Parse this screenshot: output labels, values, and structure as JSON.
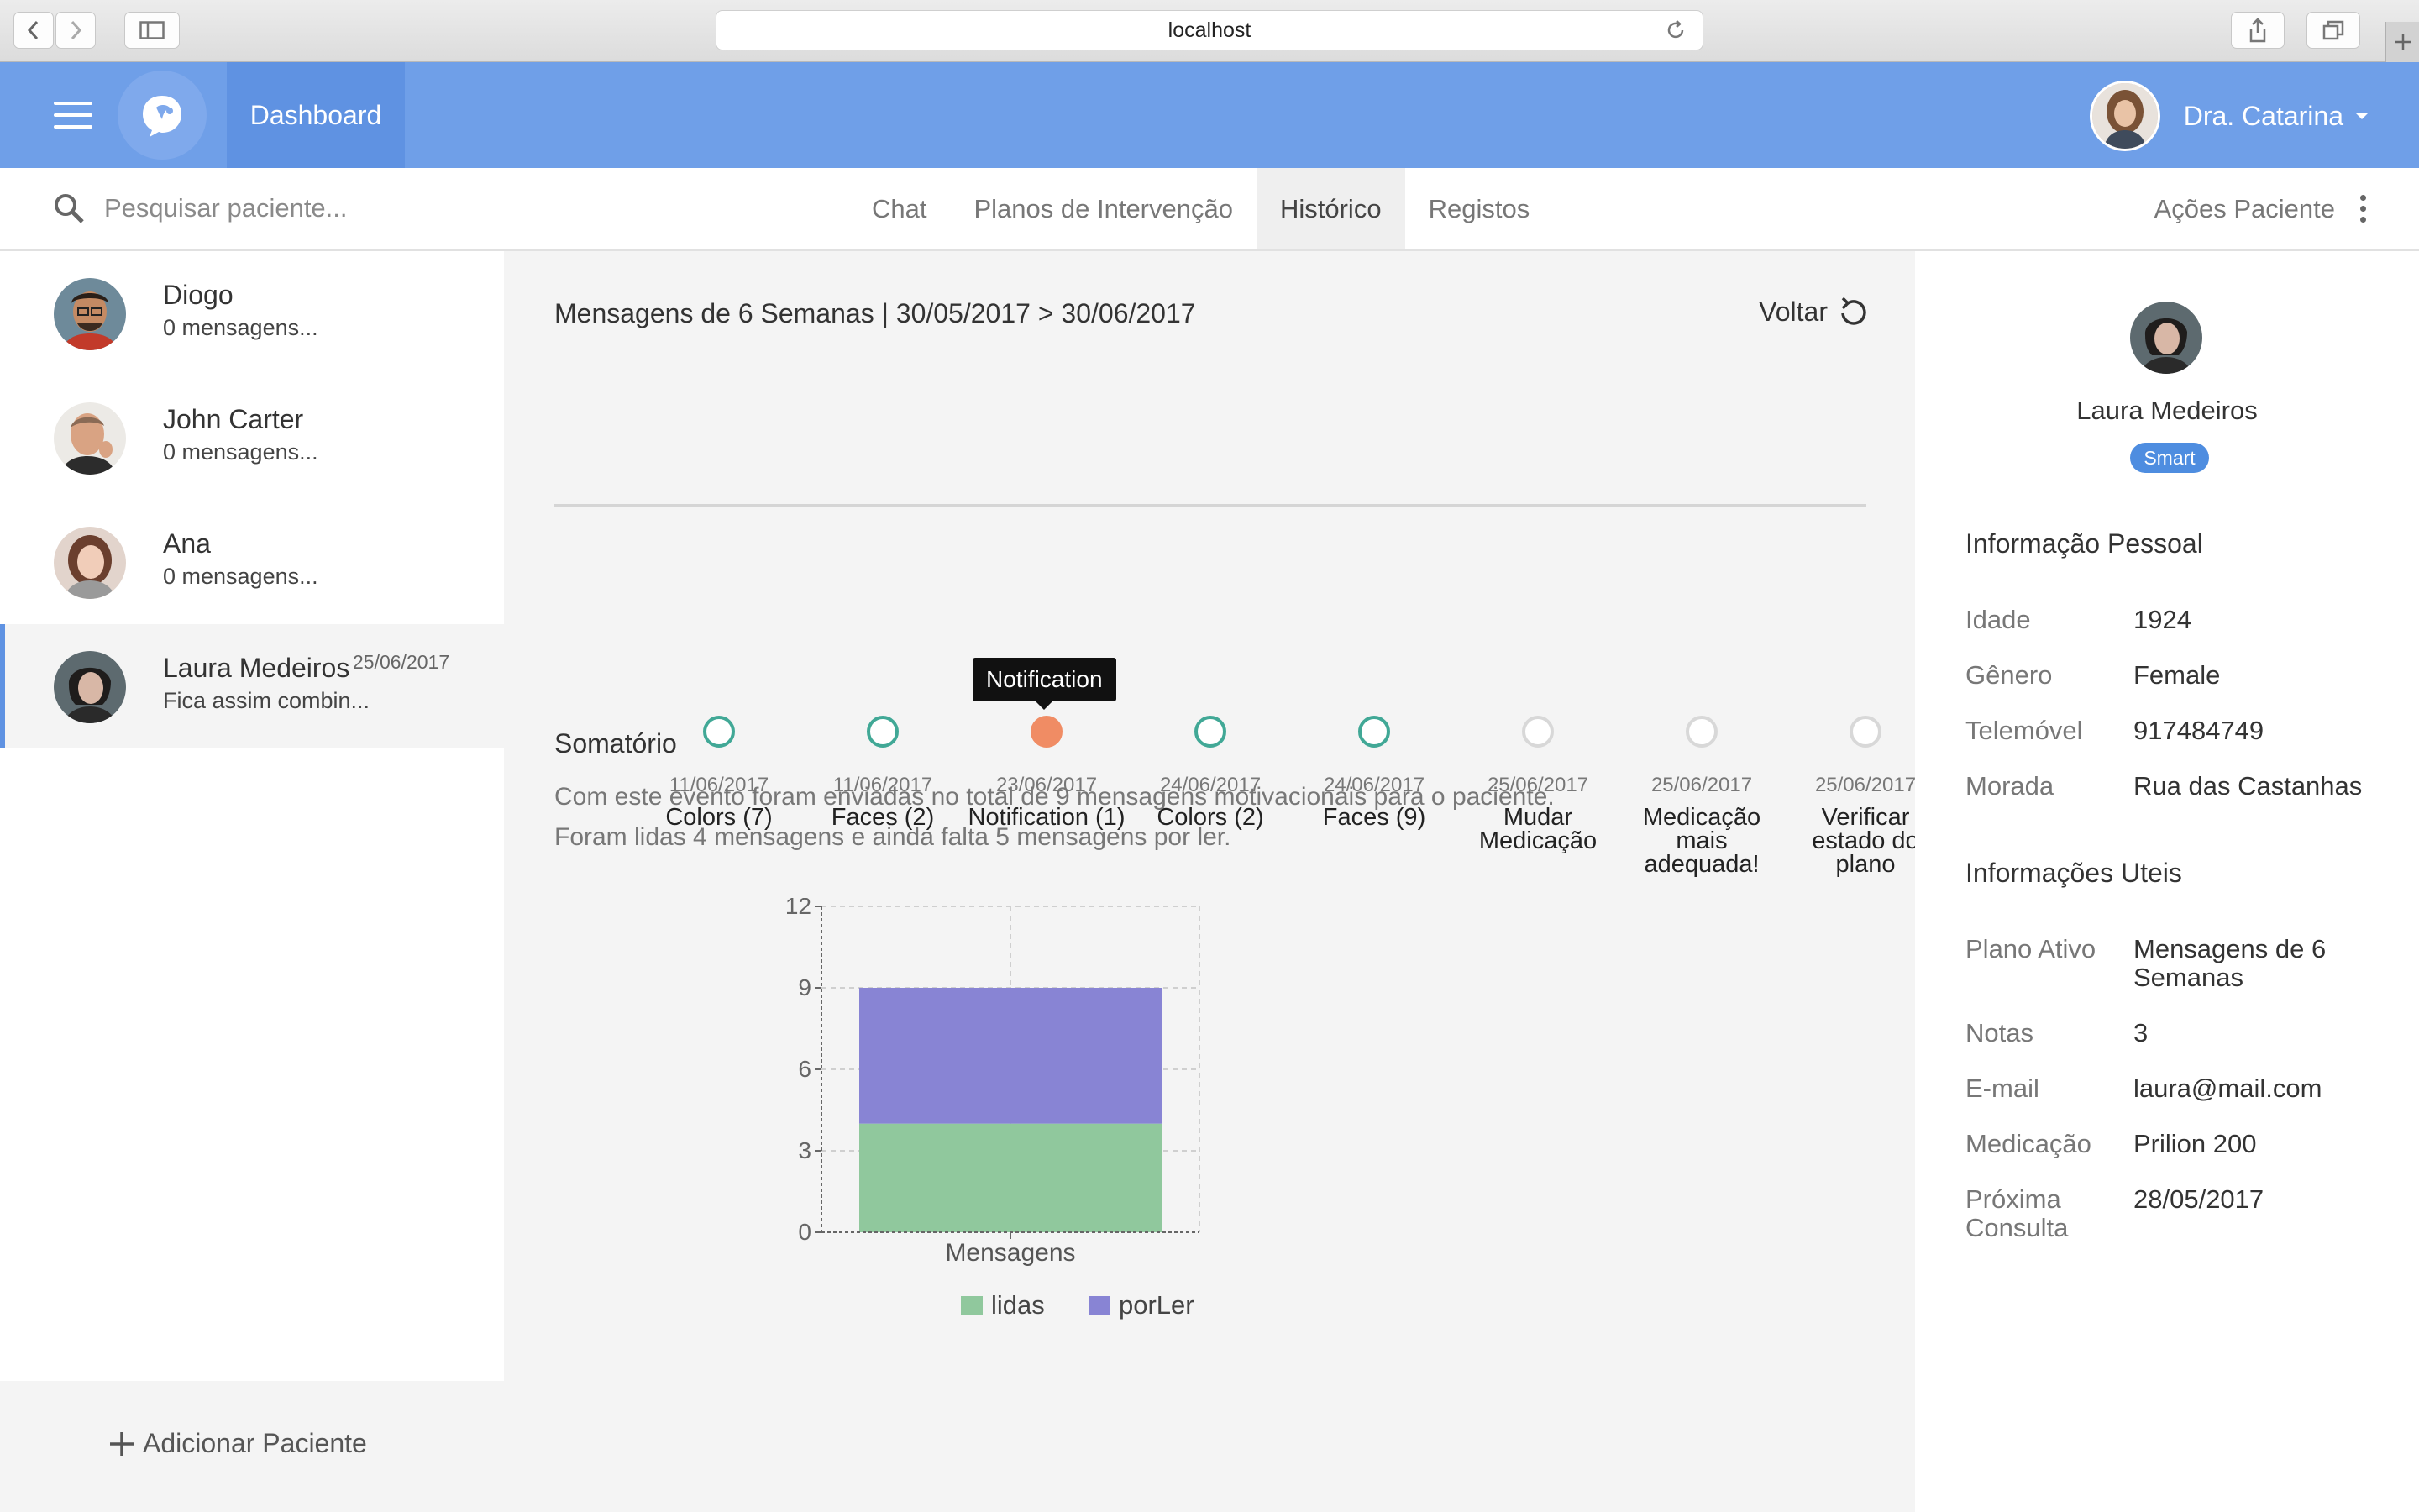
{
  "browser": {
    "url": "localhost"
  },
  "header": {
    "dashboard_label": "Dashboard",
    "user_name": "Dra. Catarina"
  },
  "subnav": {
    "search_placeholder": "Pesquisar paciente...",
    "tabs": [
      "Chat",
      "Planos de Intervenção",
      "Histórico",
      "Registos"
    ],
    "active_tab": "Histórico",
    "actions_label": "Ações Paciente"
  },
  "patients": [
    {
      "name": "Diogo",
      "preview": "0 mensagens...",
      "date": ""
    },
    {
      "name": "John Carter",
      "preview": "0 mensagens...",
      "date": ""
    },
    {
      "name": "Ana",
      "preview": "0 mensagens...",
      "date": ""
    },
    {
      "name": "Laura Medeiros",
      "preview": "Fica assim combin...",
      "date": "25/06/2017"
    }
  ],
  "add_patient_label": "Adicionar Paciente",
  "main": {
    "period_title": "Mensagens de 6 Semanas | 30/05/2017 > 30/06/2017",
    "back_label": "Voltar",
    "tooltip": "Notification",
    "timeline": [
      {
        "date": "11/06/2017",
        "label": "Colors (7)",
        "state": "done"
      },
      {
        "date": "11/06/2017",
        "label": "Faces (2)",
        "state": "done"
      },
      {
        "date": "23/06/2017",
        "label": "Notification (1)",
        "state": "active"
      },
      {
        "date": "24/06/2017",
        "label": "Colors (2)",
        "state": "done"
      },
      {
        "date": "24/06/2017",
        "label": "Faces (9)",
        "state": "done"
      },
      {
        "date": "25/06/2017",
        "label": "Mudar Medicação",
        "state": "pending"
      },
      {
        "date": "25/06/2017",
        "label": "Medicação mais adequada!",
        "state": "pending"
      },
      {
        "date": "25/06/2017",
        "label": "Verificar estado do plano",
        "state": "pending"
      }
    ],
    "summary_title": "Somatório",
    "summary_line1": "Com este evento foram enviadas no total de 9 mensagens motivacionais para o paciente.",
    "summary_line2": "Foram lidas 4 mensagens e ainda falta 5 mensagens por ler."
  },
  "chart_data": {
    "type": "bar",
    "stacked": true,
    "categories": [
      "Mensagens"
    ],
    "series": [
      {
        "name": "lidas",
        "values": [
          4
        ],
        "color": "#90c89d"
      },
      {
        "name": "porLer",
        "values": [
          5
        ],
        "color": "#8884d4"
      }
    ],
    "yticks": [
      0,
      3,
      6,
      9,
      12
    ],
    "ylim": [
      0,
      12
    ],
    "grid": true,
    "legend": "bottom"
  },
  "profile": {
    "name": "Laura Medeiros",
    "badge": "Smart",
    "personal_title": "Informação Pessoal",
    "personal": [
      {
        "key": "Idade",
        "value": "1924"
      },
      {
        "key": "Gênero",
        "value": "Female"
      },
      {
        "key": "Telemóvel",
        "value": "917484749"
      },
      {
        "key": "Morada",
        "value": "Rua das Castanhas"
      }
    ],
    "useful_title": "Informações Uteis",
    "useful": [
      {
        "key": "Plano Ativo",
        "value": "Mensagens de 6 Semanas"
      },
      {
        "key": "Notas",
        "value": "3"
      },
      {
        "key": "E-mail",
        "value": "laura@mail.com"
      },
      {
        "key": "Medicação",
        "value": "Prilion 200"
      },
      {
        "key": "Próxima Consulta",
        "value": "28/05/2017"
      }
    ]
  }
}
